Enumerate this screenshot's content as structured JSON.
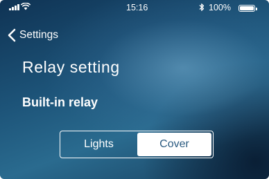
{
  "status_bar": {
    "time": "15:16",
    "battery_percent": "100%",
    "battery_level": 1.0,
    "icons": [
      "signal-icon",
      "wifi-icon",
      "bluetooth-icon",
      "battery-icon"
    ]
  },
  "nav": {
    "back_label": "Settings",
    "back_icon": "chevron-left-icon"
  },
  "page": {
    "title": "Relay setting",
    "section_label": "Built-in relay"
  },
  "relay_mode": {
    "options": [
      "Lights",
      "Cover"
    ],
    "selected": "Cover"
  },
  "colors": {
    "background": "#1d5479",
    "selected_segment_bg": "#ffffff",
    "selected_segment_text": "#2a5a80"
  }
}
